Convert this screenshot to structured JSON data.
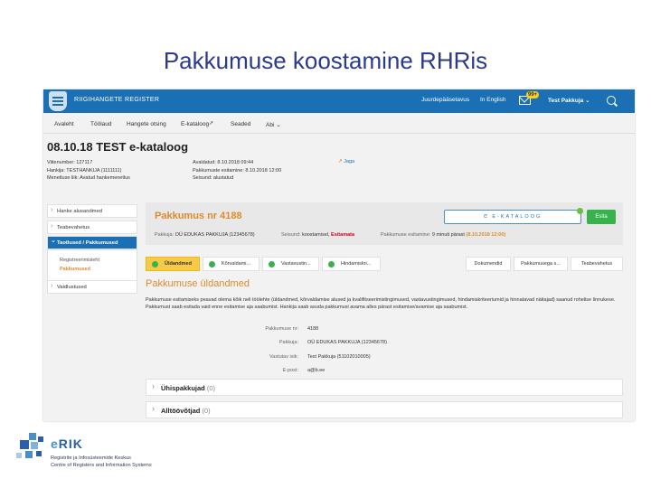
{
  "slide_title": "Pakkumuse koostamine RHRis",
  "topbar": {
    "brand": "Riigihangete Register",
    "links": [
      "Juurdepääsetavus",
      "In English"
    ],
    "mail_badge": "99+",
    "user": "Test Pakkuja ⌄"
  },
  "nav": [
    "Avaleht",
    "Töölaud",
    "Hangete otsing",
    "E-kataloog",
    "Seaded",
    "Abi ⌄"
  ],
  "page": {
    "title": "08.10.18 TEST e-kataloog",
    "meta_left": [
      "Viitenumber: 127117",
      "Hankija: TESTHANKIJA (1111111)",
      "Menetluse liik: Avatud hankemenetlus"
    ],
    "meta_right": [
      "Avaldatud: 8.10.2018 09:44",
      "Pakkumuste esitamine: 8.10.2018 12:00",
      "Seisund: alustatud"
    ],
    "share": "Jaga"
  },
  "sidebar": {
    "items": [
      "Hanke alusandmed",
      "Teabevahetus",
      "Taotlused / Pakkumused",
      "Vaidlustused"
    ],
    "sub": [
      "Registreerimisleht",
      "Pakkumused"
    ]
  },
  "offer": {
    "title": "Pakkumus nr 4188",
    "pakkuja_label": "Pakkuja:",
    "pakkuja_value": "OÜ EDUKAS PAKKUJA (12345678)",
    "seisund_label": "Seisund:",
    "seisund_value": "koostamisel,",
    "seisund_flag": "Esitamata",
    "esitamine_label": "Pakkumuse esitamine:",
    "esitamine_value": "9 minuti pärast",
    "esitamine_date": "(8.10.2018 12:00)",
    "ekataloog_button": "E-KATALOOG",
    "send_button": "Esita"
  },
  "tabs": [
    "Üldandmed",
    "Kõrvaldami...",
    "Vastavustin...",
    "Hindamiskri...",
    "Dokumendid",
    "Pakkumusega s...",
    "Teabevahetus"
  ],
  "section": {
    "heading": "Pakkumuse üldandmed",
    "paragraph": "Pakkumuse esitamiseks peavad olema kõik neli töölehte (üldandmed, kõrvaldamise alused ja kvalifitseerimistingimused, vastavustingimused, hindamiskriteeriumid ja hinnatavad näitajad) saanud rohelise linnukese. Pakkumust saab esitada vaid enne esitamise aja saabumist. Hankija saab asuda pakkumusi avama alles pärast esitamise/avamise aja saabumist.",
    "fields": [
      {
        "label": "Pakkumuse nr:",
        "value": "4188"
      },
      {
        "label": "Pakkuja:",
        "value": "OÜ EDUKAS PAKKUJA (12345678)"
      },
      {
        "label": "Vastutav isik:",
        "value": "Test Pakkuja (51102010005)"
      },
      {
        "label": "E-post:",
        "value": "a@b.ee"
      }
    ]
  },
  "accordions": [
    {
      "label": "Ühispakkujad",
      "count": "(0)"
    },
    {
      "label": "Alltöövõtjad",
      "count": "(0)"
    }
  ],
  "footer": {
    "logo_text": "RIK",
    "line1": "Registrite ja Infosüsteemide Keskus",
    "line2": "Centre of Registers and Information Systems"
  },
  "colors": {
    "primary": "#1a6fb5",
    "accent": "#e08a2c",
    "success": "#37b24d",
    "title": "#2b3a8c"
  }
}
